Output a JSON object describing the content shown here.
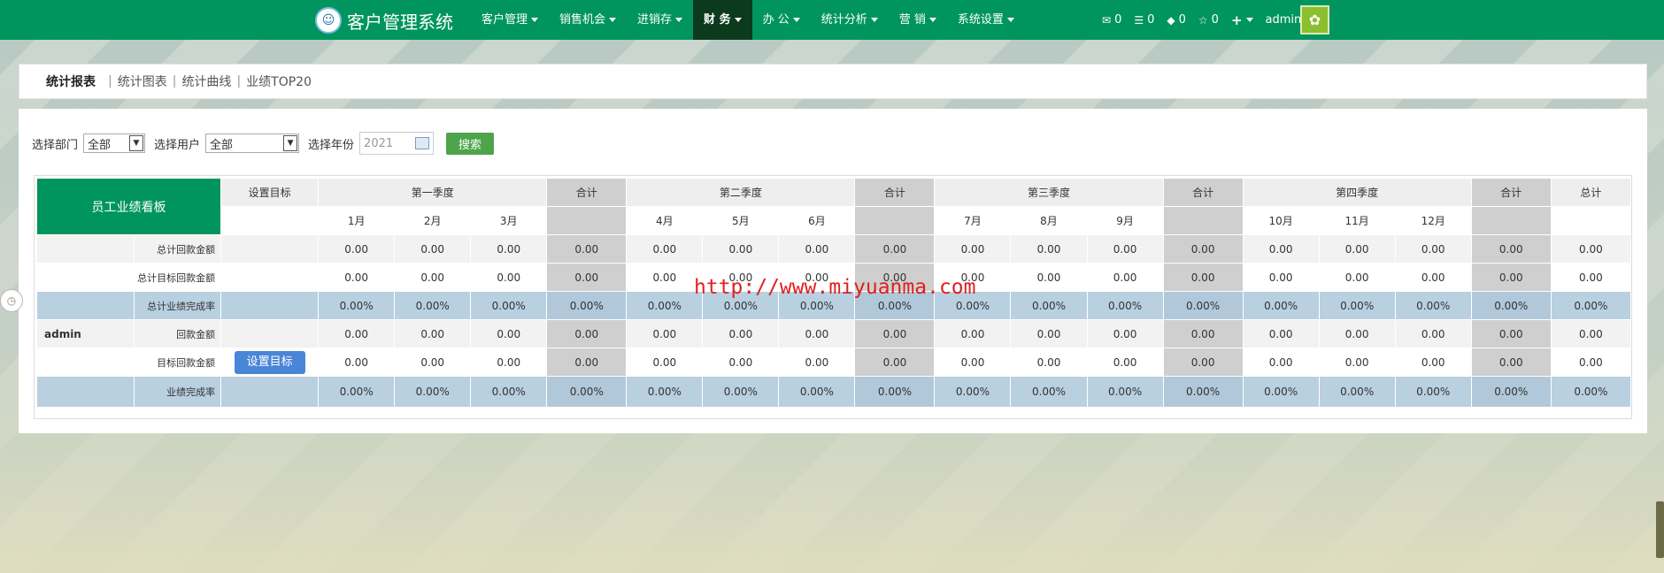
{
  "brand": {
    "name": "客户管理系统",
    "logo_icon": "monkey-logo-icon"
  },
  "menu": [
    {
      "label": "客户管理",
      "active": false
    },
    {
      "label": "销售机会",
      "active": false
    },
    {
      "label": "进销存",
      "active": false
    },
    {
      "label": "财 务",
      "active": true
    },
    {
      "label": "办 公",
      "active": false
    },
    {
      "label": "统计分析",
      "active": false
    },
    {
      "label": "营 销",
      "active": false
    },
    {
      "label": "系统设置",
      "active": false
    }
  ],
  "nav_right": {
    "mail_count": "0",
    "list_count": "0",
    "tasks_count": "0",
    "star_count": "0",
    "user": "admin"
  },
  "tabs": [
    {
      "label": "统计报表",
      "active": true
    },
    {
      "label": "统计图表",
      "active": false
    },
    {
      "label": "统计曲线",
      "active": false
    },
    {
      "label": "业绩TOP20",
      "active": false
    }
  ],
  "tab_separators": [
    "|",
    "|",
    "|"
  ],
  "filters": {
    "dept_label": "选择部门",
    "dept_value": "全部",
    "user_label": "选择用户",
    "user_value": "全部",
    "year_label": "选择年份",
    "year_placeholder": "2021",
    "search_label": "搜索"
  },
  "table": {
    "board_title": "员工业绩看板",
    "set_target_header": "设置目标",
    "quarters": [
      "第一季度",
      "第二季度",
      "第三季度",
      "第四季度"
    ],
    "sum_label": "合计",
    "total_label": "总计",
    "months": [
      "1月",
      "2月",
      "3月",
      "4月",
      "5月",
      "6月",
      "7月",
      "8月",
      "9月",
      "10月",
      "11月",
      "12月"
    ],
    "rows": [
      {
        "label": "总计回款金额",
        "vals": [
          "0.00",
          "0.00",
          "0.00",
          "0.00",
          "0.00",
          "0.00",
          "0.00",
          "0.00",
          "0.00",
          "0.00",
          "0.00",
          "0.00",
          "0.00",
          "0.00",
          "0.00",
          "0.00",
          "0.00"
        ]
      },
      {
        "label": "总计目标回款金额",
        "vals": [
          "0.00",
          "0.00",
          "0.00",
          "0.00",
          "0.00",
          "0.00",
          "0.00",
          "0.00",
          "0.00",
          "0.00",
          "0.00",
          "0.00",
          "0.00",
          "0.00",
          "0.00",
          "0.00",
          "0.00"
        ]
      },
      {
        "label": "总计业绩完成率",
        "vals": [
          "0.00%",
          "0.00%",
          "0.00%",
          "0.00%",
          "0.00%",
          "0.00%",
          "0.00%",
          "0.00%",
          "0.00%",
          "0.00%",
          "0.00%",
          "0.00%",
          "0.00%",
          "0.00%",
          "0.00%",
          "0.00%",
          "0.00%"
        ]
      },
      {
        "user": "admin",
        "label": "回款金额",
        "vals": [
          "0.00",
          "0.00",
          "0.00",
          "0.00",
          "0.00",
          "0.00",
          "0.00",
          "0.00",
          "0.00",
          "0.00",
          "0.00",
          "0.00",
          "0.00",
          "0.00",
          "0.00",
          "0.00",
          "0.00"
        ]
      },
      {
        "label": "目标回款金额",
        "button": "设置目标",
        "vals": [
          "0.00",
          "0.00",
          "0.00",
          "0.00",
          "0.00",
          "0.00",
          "0.00",
          "0.00",
          "0.00",
          "0.00",
          "0.00",
          "0.00",
          "0.00",
          "0.00",
          "0.00",
          "0.00",
          "0.00"
        ]
      },
      {
        "label": "业绩完成率",
        "vals": [
          "0.00%",
          "0.00%",
          "0.00%",
          "0.00%",
          "0.00%",
          "0.00%",
          "0.00%",
          "0.00%",
          "0.00%",
          "0.00%",
          "0.00%",
          "0.00%",
          "0.00%",
          "0.00%",
          "0.00%",
          "0.00%",
          "0.00%"
        ]
      }
    ]
  },
  "watermark": "http://www.miyuanma.com",
  "colors": {
    "nav": "#00955f",
    "active_menu": "#0c3a1d",
    "search_btn": "#4ea44b",
    "target_btn": "#4a86d8",
    "rate_row": "#b9d0e1"
  }
}
